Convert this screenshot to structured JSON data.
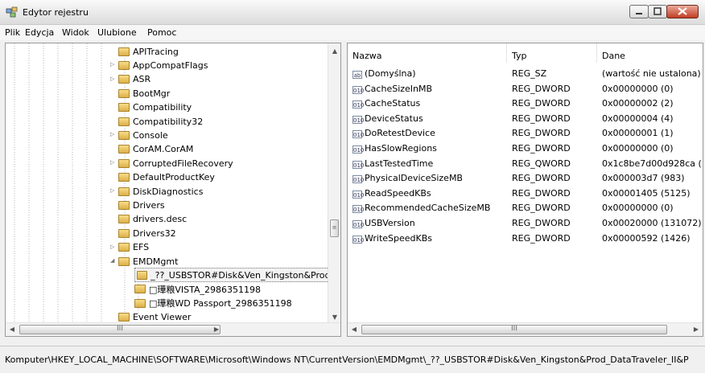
{
  "window": {
    "title": "Edytor rejestru"
  },
  "menu": [
    "Plik",
    "Edycja",
    "Widok",
    "Ulubione",
    "Pomoc"
  ],
  "tree": [
    {
      "label": "APITracing",
      "depth": 1,
      "expander": ""
    },
    {
      "label": "AppCompatFlags",
      "depth": 1,
      "expander": "▷"
    },
    {
      "label": "ASR",
      "depth": 1,
      "expander": "▷"
    },
    {
      "label": "BootMgr",
      "depth": 1,
      "expander": ""
    },
    {
      "label": "Compatibility",
      "depth": 1,
      "expander": ""
    },
    {
      "label": "Compatibility32",
      "depth": 1,
      "expander": ""
    },
    {
      "label": "Console",
      "depth": 1,
      "expander": "▷"
    },
    {
      "label": "CorAM.CorAM",
      "depth": 1,
      "expander": ""
    },
    {
      "label": "CorruptedFileRecovery",
      "depth": 1,
      "expander": "▷"
    },
    {
      "label": "DefaultProductKey",
      "depth": 1,
      "expander": ""
    },
    {
      "label": "DiskDiagnostics",
      "depth": 1,
      "expander": "▷"
    },
    {
      "label": "Drivers",
      "depth": 1,
      "expander": ""
    },
    {
      "label": "drivers.desc",
      "depth": 1,
      "expander": ""
    },
    {
      "label": "Drivers32",
      "depth": 1,
      "expander": ""
    },
    {
      "label": "EFS",
      "depth": 1,
      "expander": "▷"
    },
    {
      "label": "EMDMgmt",
      "depth": 1,
      "expander": "◢"
    },
    {
      "label": "_??_USBSTOR#Disk&Ven_Kingston&Prod_",
      "depth": 2,
      "expander": "",
      "selected": true
    },
    {
      "label": "□璍粮VISTA_2986351198",
      "depth": 2,
      "expander": ""
    },
    {
      "label": "□璍粮WD Passport_2986351198",
      "depth": 2,
      "expander": ""
    },
    {
      "label": "Event Viewer",
      "depth": 1,
      "expander": ""
    }
  ],
  "columns": {
    "name": "Nazwa",
    "type": "Typ",
    "data": "Dane"
  },
  "values": [
    {
      "icon": "ab",
      "name": "(Domyślna)",
      "type": "REG_SZ",
      "data": "(wartość nie ustalona)"
    },
    {
      "icon": "010",
      "name": "CacheSizeInMB",
      "type": "REG_DWORD",
      "data": "0x00000000 (0)"
    },
    {
      "icon": "010",
      "name": "CacheStatus",
      "type": "REG_DWORD",
      "data": "0x00000002 (2)"
    },
    {
      "icon": "010",
      "name": "DeviceStatus",
      "type": "REG_DWORD",
      "data": "0x00000004 (4)"
    },
    {
      "icon": "010",
      "name": "DoRetestDevice",
      "type": "REG_DWORD",
      "data": "0x00000001 (1)"
    },
    {
      "icon": "010",
      "name": "HasSlowRegions",
      "type": "REG_DWORD",
      "data": "0x00000000 (0)"
    },
    {
      "icon": "010",
      "name": "LastTestedTime",
      "type": "REG_QWORD",
      "data": "0x1c8be7d00d928ca (12"
    },
    {
      "icon": "010",
      "name": "PhysicalDeviceSizeMB",
      "type": "REG_DWORD",
      "data": "0x000003d7 (983)"
    },
    {
      "icon": "010",
      "name": "ReadSpeedKBs",
      "type": "REG_DWORD",
      "data": "0x00001405 (5125)"
    },
    {
      "icon": "010",
      "name": "RecommendedCacheSizeMB",
      "type": "REG_DWORD",
      "data": "0x00000000 (0)"
    },
    {
      "icon": "010",
      "name": "USBVersion",
      "type": "REG_DWORD",
      "data": "0x00020000 (131072)"
    },
    {
      "icon": "010",
      "name": "WriteSpeedKBs",
      "type": "REG_DWORD",
      "data": "0x00000592 (1426)"
    }
  ],
  "status": {
    "path": "Komputer\\HKEY_LOCAL_MACHINE\\SOFTWARE\\Microsoft\\Windows NT\\CurrentVersion\\EMDMgmt\\_??_USBSTOR#Disk&Ven_Kingston&Prod_DataTraveler_II&P"
  },
  "scroll": {
    "grip": "III",
    "up": "▲",
    "down": "▼",
    "left": "◀",
    "right": "▶"
  }
}
